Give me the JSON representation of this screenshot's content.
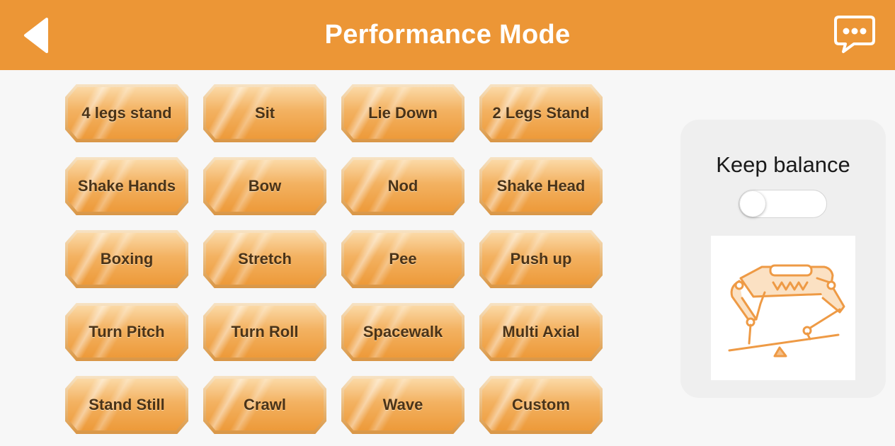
{
  "header": {
    "title": "Performance Mode",
    "back_icon": "back-arrow-icon",
    "chat_icon": "chat-bubble-icon",
    "color": "#ec9636"
  },
  "actions": [
    "4 legs stand",
    "Sit",
    "Lie Down",
    "2 Legs Stand",
    "Shake Hands",
    "Bow",
    "Nod",
    "Shake Head",
    "Boxing",
    "Stretch",
    "Pee",
    "Push up",
    "Turn Pitch",
    "Turn Roll",
    "Spacewalk",
    "Multi Axial",
    "Stand Still",
    "Crawl",
    "Wave",
    "Custom"
  ],
  "side_panel": {
    "title": "Keep balance",
    "toggle_on": false,
    "image_icon": "robot-dog-balance-icon"
  },
  "colors": {
    "accent": "#ec9636",
    "button_text": "#4a3318",
    "panel_bg": "#efefef"
  }
}
